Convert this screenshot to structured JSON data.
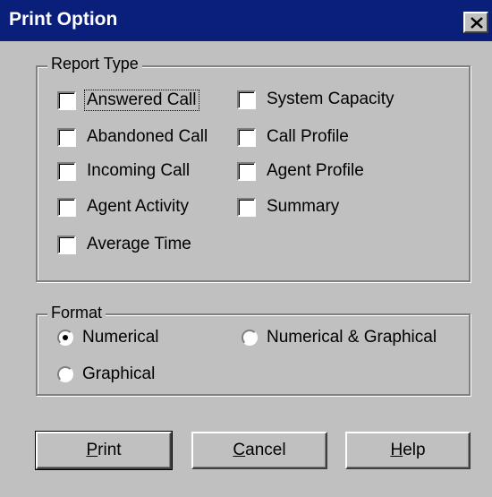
{
  "window": {
    "title": "Print Option"
  },
  "report_type": {
    "legend": "Report Type",
    "items": [
      {
        "label": "Answered Call",
        "checked": false
      },
      {
        "label": "Abandoned Call",
        "checked": false
      },
      {
        "label": "Incoming Call",
        "checked": false
      },
      {
        "label": "Agent Activity",
        "checked": false
      },
      {
        "label": "Average Time",
        "checked": false
      },
      {
        "label": "System Capacity",
        "checked": false
      },
      {
        "label": "Call Profile",
        "checked": false
      },
      {
        "label": "Agent Profile",
        "checked": false
      },
      {
        "label": "Summary",
        "checked": false
      }
    ]
  },
  "format": {
    "legend": "Format",
    "options": [
      {
        "label": "Numerical",
        "selected": true
      },
      {
        "label": "Numerical & Graphical",
        "selected": false
      },
      {
        "label": "Graphical",
        "selected": false
      }
    ]
  },
  "buttons": {
    "print": {
      "mnemonic": "P",
      "rest": "rint"
    },
    "cancel": {
      "mnemonic": "C",
      "rest": "ancel"
    },
    "help": {
      "mnemonic": "H",
      "rest": "elp"
    }
  },
  "icons": {
    "close": "close-icon"
  }
}
